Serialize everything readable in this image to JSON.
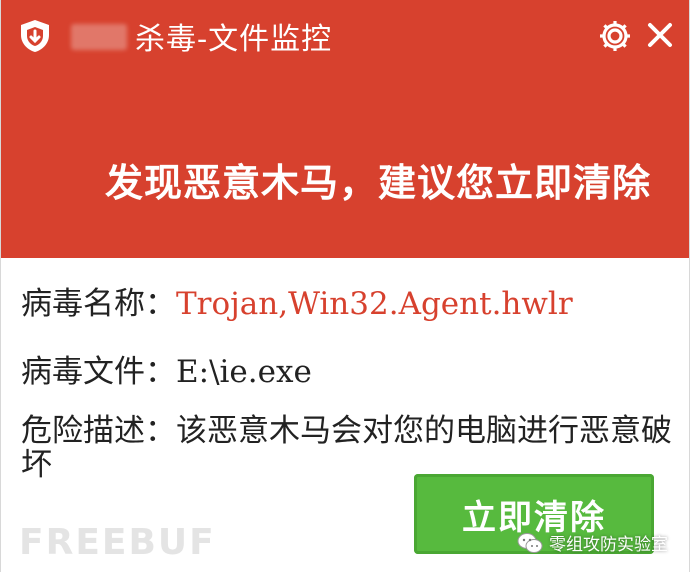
{
  "window": {
    "title": "杀毒-文件监控"
  },
  "alert": {
    "headline": "发现恶意木马，建议您立即清除"
  },
  "details": {
    "virus_name_label": "病毒名称：",
    "virus_name_value": "Trojan,Win32.Agent.hwlr",
    "virus_file_label": "病毒文件：",
    "virus_file_value": "E:\\ie.exe",
    "risk_label": "危险描述：",
    "risk_value": "该恶意木马会对您的电脑进行恶意破坏"
  },
  "actions": {
    "clean_label": "立即清除"
  },
  "overlay": {
    "watermark": "FREEBUF",
    "wechat_account": "零组攻防实验室"
  },
  "colors": {
    "header_bg": "#d7412e",
    "virus_name": "#d7412e",
    "button_bg": "#57ba3e"
  },
  "icons": [
    "shield-icon",
    "gear-icon",
    "close-icon",
    "wechat-icon"
  ]
}
